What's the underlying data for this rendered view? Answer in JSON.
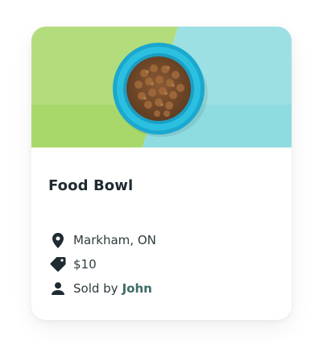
{
  "listing": {
    "title": "Food Bowl",
    "location": "Markham, ON",
    "price": "$10",
    "seller_prefix": "Sold by",
    "seller_name": "John"
  },
  "icons": {
    "location": "map-pin-icon",
    "price": "price-tag-icon",
    "seller": "person-icon"
  },
  "colors": {
    "photo_background_left": "#a9d86a",
    "photo_background_right": "#8fdce0",
    "bowl": "#29b6d6",
    "title_text": "#1e2b30",
    "seller_link": "#3e6b67"
  }
}
